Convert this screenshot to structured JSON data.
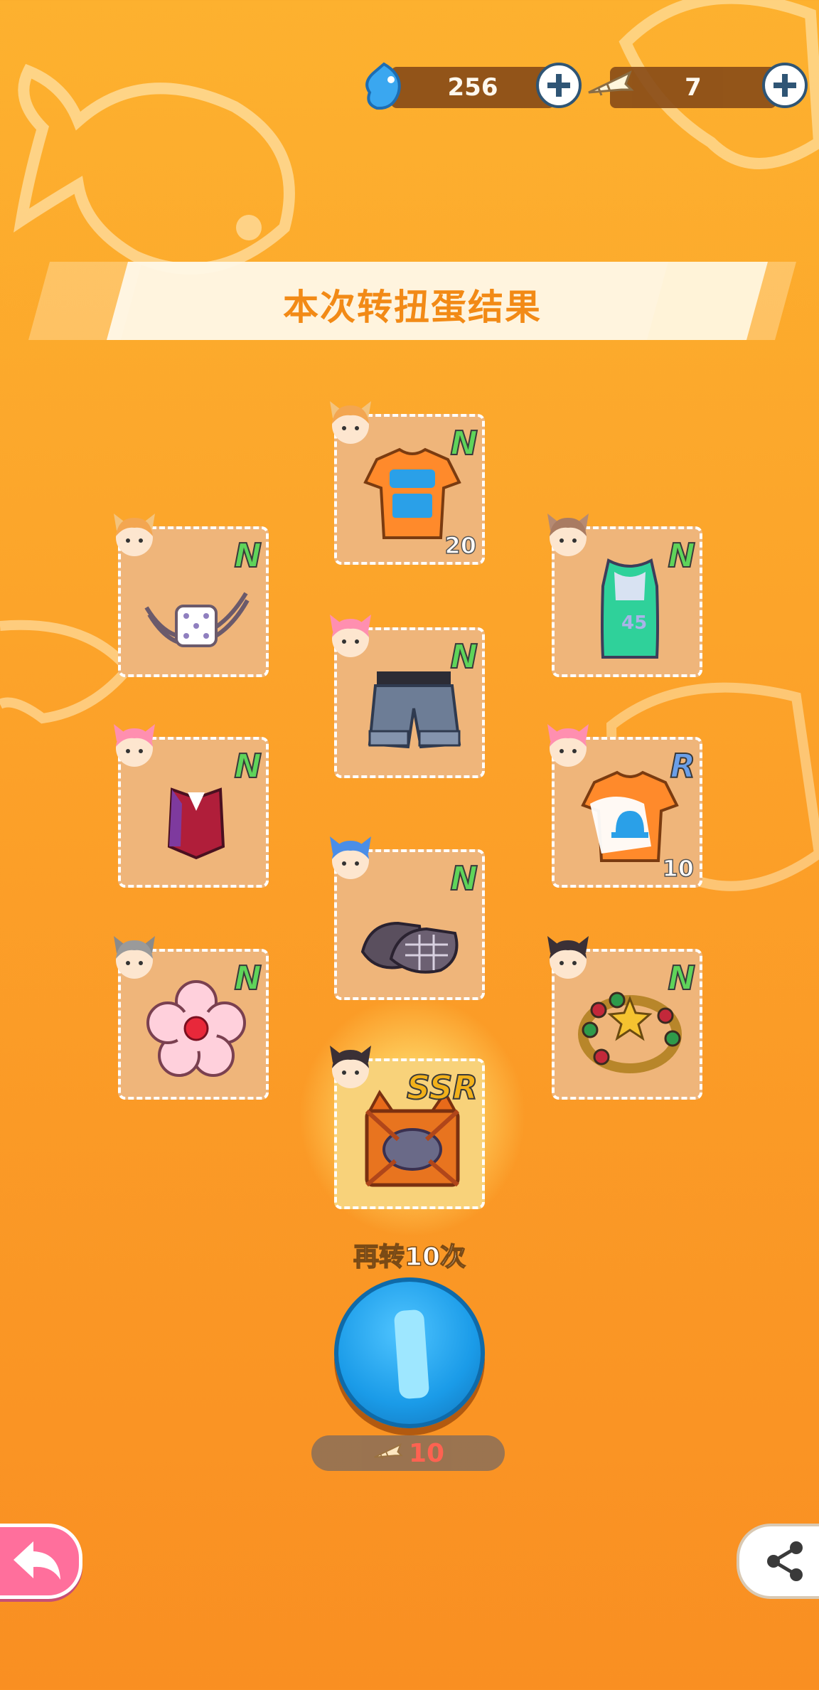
{
  "currencies": [
    {
      "name": "gem-currency",
      "value": "256",
      "icon": "blue-fish-gem-icon"
    },
    {
      "name": "fishbone-currency",
      "value": "7",
      "icon": "fishbone-ticket-icon"
    }
  ],
  "banner": {
    "title": "本次转扭蛋结果"
  },
  "items": [
    {
      "id": "orange-team-shirt",
      "rarity": "N",
      "count": "20",
      "icon": "orange-tshirt-icon"
    },
    {
      "id": "dice-choker",
      "rarity": "N",
      "count": "",
      "icon": "dice-choker-icon"
    },
    {
      "id": "green-jersey",
      "rarity": "N",
      "count": "",
      "icon": "green-jersey-icon"
    },
    {
      "id": "denim-shorts",
      "rarity": "N",
      "count": "",
      "icon": "denim-shorts-icon"
    },
    {
      "id": "red-vest",
      "rarity": "N",
      "count": "",
      "icon": "red-vest-icon"
    },
    {
      "id": "orange-bell-shirt",
      "rarity": "R",
      "count": "10",
      "icon": "bell-tshirt-icon"
    },
    {
      "id": "plaid-shoes",
      "rarity": "N",
      "count": "",
      "icon": "plaid-shoes-icon"
    },
    {
      "id": "flower-pin",
      "rarity": "N",
      "count": "",
      "icon": "flower-pin-icon"
    },
    {
      "id": "star-bracelet",
      "rarity": "N",
      "count": "",
      "icon": "star-bracelet-icon"
    },
    {
      "id": "cat-box",
      "rarity": "SSR",
      "count": "",
      "icon": "cat-box-icon"
    }
  ],
  "actions": {
    "retry_label": "再转10次",
    "cost_value": "10",
    "back_icon": "back-arrow-icon",
    "share_icon": "share-icon"
  },
  "colors": {
    "background": "#fca129",
    "title_text": "#f28a16",
    "rarity_n": "#5fd45a",
    "rarity_r": "#6b9fe8",
    "rarity_ssr": "#f2b11a",
    "cost_text": "#ff5a5a",
    "spin_button": "#1a9be8"
  }
}
